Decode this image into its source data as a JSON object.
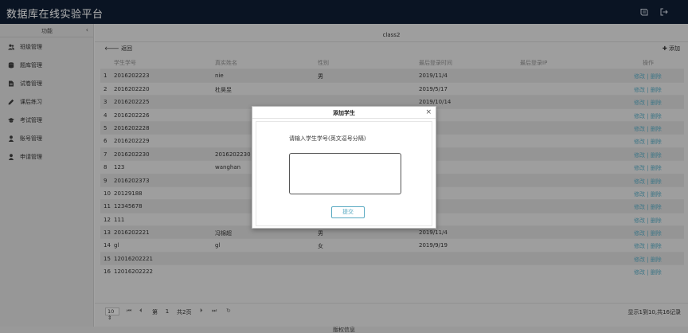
{
  "app": {
    "title": "数据库在线实验平台"
  },
  "sidebar": {
    "header": "功能",
    "items": [
      {
        "label": "班级管理",
        "icon": "users-icon"
      },
      {
        "label": "题库管理",
        "icon": "database-icon"
      },
      {
        "label": "试卷管理",
        "icon": "file-icon"
      },
      {
        "label": "课后练习",
        "icon": "pencil-icon"
      },
      {
        "label": "考试管理",
        "icon": "graduation-cap-icon"
      },
      {
        "label": "账号管理",
        "icon": "user-icon"
      },
      {
        "label": "申请管理",
        "icon": "user-icon"
      }
    ]
  },
  "main": {
    "class_name": "class2",
    "back_label": "返回",
    "add_label": "添加",
    "columns": [
      "学生学号",
      "真实姓名",
      "性别",
      "最后登录时间",
      "最后登录IP",
      "操作"
    ],
    "rows": [
      {
        "idx": "1",
        "id": "2016202223",
        "name": "nie",
        "sex": "男",
        "time": "2019/11/4",
        "ip": ""
      },
      {
        "idx": "2",
        "id": "2016202220",
        "name": "杜昊昱",
        "sex": "",
        "time": "2019/5/17",
        "ip": ""
      },
      {
        "idx": "3",
        "id": "2016202225",
        "name": "",
        "sex": "",
        "time": "2019/10/14",
        "ip": ""
      },
      {
        "idx": "4",
        "id": "2016202226",
        "name": "",
        "sex": "",
        "time": "",
        "ip": ""
      },
      {
        "idx": "5",
        "id": "2016202228",
        "name": "",
        "sex": "",
        "time": "",
        "ip": ""
      },
      {
        "idx": "6",
        "id": "2016202229",
        "name": "",
        "sex": "",
        "time": "",
        "ip": ""
      },
      {
        "idx": "7",
        "id": "2016202230",
        "name": "2016202230",
        "sex": "",
        "time": "",
        "ip": ""
      },
      {
        "idx": "8",
        "id": "123",
        "name": "wanghan",
        "sex": "",
        "time": "1/4",
        "ip": ""
      },
      {
        "idx": "9",
        "id": "2016202373",
        "name": "",
        "sex": "",
        "time": "",
        "ip": ""
      },
      {
        "idx": "10",
        "id": "20129188",
        "name": "",
        "sex": "",
        "time": "",
        "ip": ""
      },
      {
        "idx": "11",
        "id": "12345678",
        "name": "",
        "sex": "",
        "time": "",
        "ip": ""
      },
      {
        "idx": "12",
        "id": "111",
        "name": "",
        "sex": "",
        "time": "5/13",
        "ip": ""
      },
      {
        "idx": "13",
        "id": "2016202221",
        "name": "冯锦超",
        "sex": "男",
        "time": "2019/11/4",
        "ip": ""
      },
      {
        "idx": "14",
        "id": "gl",
        "name": "gl",
        "sex": "女",
        "time": "2019/9/19",
        "ip": ""
      },
      {
        "idx": "15",
        "id": "12016202221",
        "name": "",
        "sex": "",
        "time": "",
        "ip": ""
      },
      {
        "idx": "16",
        "id": "12016202222",
        "name": "",
        "sex": "",
        "time": "",
        "ip": ""
      }
    ],
    "edit_label": "修改",
    "op_separator": " | ",
    "delete_label": "删除"
  },
  "pager": {
    "page_size": "10",
    "page_prefix": "第",
    "current_page": "1",
    "total_pages_text": "共2页",
    "info": "显示1到10,共16记录"
  },
  "footer": {
    "text": "版权信息"
  },
  "modal": {
    "title": "添加学生",
    "close": "×",
    "prompt": "请输入学生学号(英文逗号分隔)",
    "textarea_value": "",
    "submit_label": "提交"
  }
}
